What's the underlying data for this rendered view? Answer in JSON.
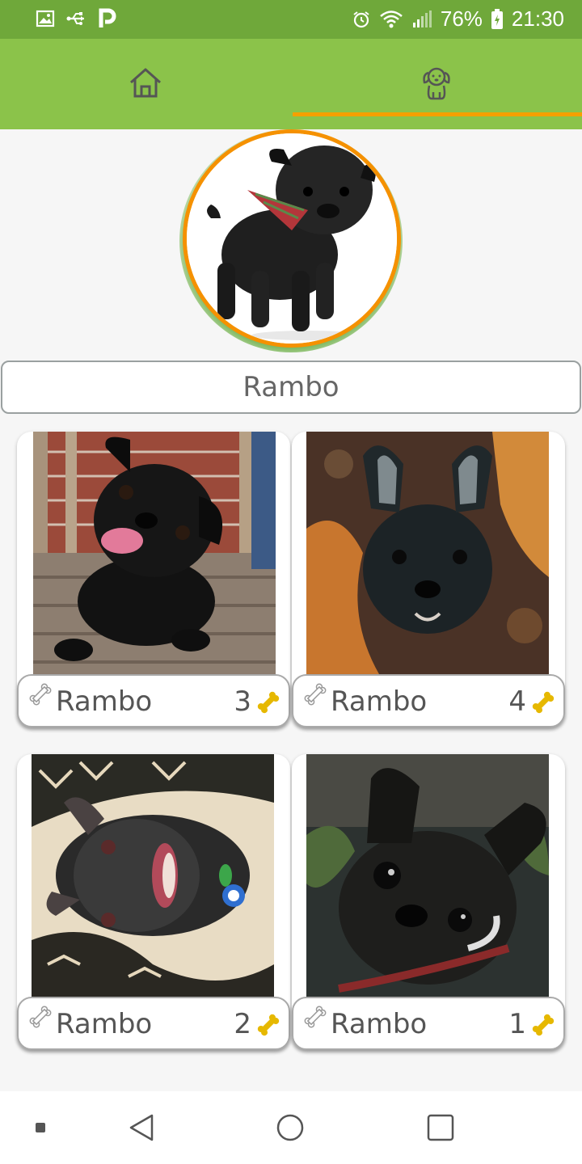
{
  "status_bar": {
    "left_icons": [
      "image-icon",
      "usb-icon",
      "parking-icon"
    ],
    "battery": "76%",
    "time": "21:30"
  },
  "tabs": [
    {
      "icon": "home-icon",
      "active": false
    },
    {
      "icon": "dog-icon",
      "active": true
    }
  ],
  "profile": {
    "name": "Rambo"
  },
  "dogs": [
    {
      "name": "Rambo",
      "count": "3"
    },
    {
      "name": "Rambo",
      "count": "4"
    },
    {
      "name": "Rambo",
      "count": "2"
    },
    {
      "name": "Rambo",
      "count": "1"
    }
  ],
  "colors": {
    "status_bar": "#6fa83a",
    "app_bar": "#8bc34a",
    "accent": "#f59100",
    "bone": "#e6b800"
  },
  "nav": [
    "recents-dot",
    "back-icon",
    "home-circle-icon",
    "overview-square-icon"
  ]
}
